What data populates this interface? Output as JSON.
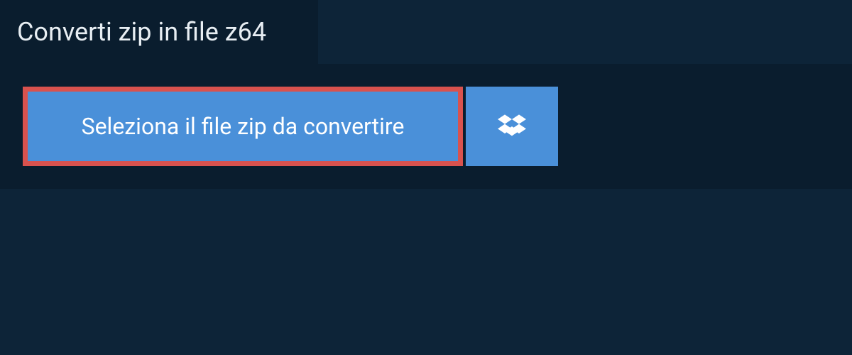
{
  "header": {
    "title": "Converti zip in file z64"
  },
  "upload": {
    "select_label": "Seleziona il file zip da convertire"
  }
}
